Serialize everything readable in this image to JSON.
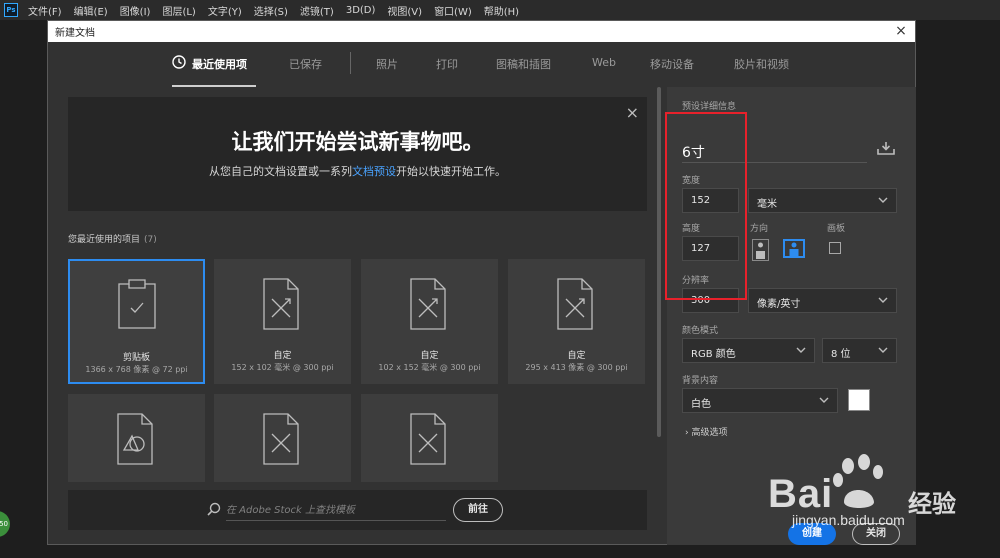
{
  "menubar": {
    "logo": "Ps",
    "items": [
      "文件(F)",
      "编辑(E)",
      "图像(I)",
      "图层(L)",
      "文字(Y)",
      "选择(S)",
      "滤镜(T)",
      "3D(D)",
      "视图(V)",
      "窗口(W)",
      "帮助(H)"
    ]
  },
  "dialog": {
    "title": "新建文档",
    "close": "×"
  },
  "tabs": [
    "最近使用项",
    "已保存",
    "照片",
    "打印",
    "图稿和插图",
    "Web",
    "移动设备",
    "胶片和视频"
  ],
  "banner": {
    "title": "让我们开始尝试新事物吧。",
    "sub_before": "从您自己的文档设置或一系列",
    "sub_link": "文档预设",
    "sub_after": "开始以快速开始工作。",
    "close": "×"
  },
  "recent": {
    "label": "您最近使用的项目",
    "count": "(7)",
    "cards": [
      {
        "name": "剪贴板",
        "size": "1366 x 768 像素 @ 72 ppi"
      },
      {
        "name": "自定",
        "size": "152 x 102 毫米 @ 300 ppi"
      },
      {
        "name": "自定",
        "size": "102 x 152 毫米 @ 300 ppi"
      },
      {
        "name": "自定",
        "size": "295 x 413 像素 @ 300 ppi"
      }
    ]
  },
  "stock": {
    "placeholder": "在 Adobe Stock 上查找模板",
    "go": "前往"
  },
  "panel": {
    "preset_label": "预设详细信息",
    "preset_name": "6寸",
    "width_label": "宽度",
    "width_value": "152",
    "width_unit": "毫米",
    "height_label": "高度",
    "height_value": "127",
    "orientation_label": "方向",
    "artboard_label": "画板",
    "resolution_label": "分辨率",
    "resolution_value": "300",
    "resolution_unit": "像素/英寸",
    "color_mode_label": "颜色模式",
    "color_mode": "RGB 颜色",
    "bit_depth": "8 位",
    "background_label": "背景内容",
    "background": "白色",
    "advanced": "高级选项",
    "create": "创建",
    "close": "关闭"
  },
  "watermark": {
    "brand": "Bai",
    "brand2": "经验",
    "url": "jingyan.baidu.com"
  },
  "badge": "50",
  "colors": {
    "accent": "#1473e6",
    "selected_border": "#2d8cf0",
    "highlight": "#e8212b",
    "link": "#4aa3ff"
  }
}
